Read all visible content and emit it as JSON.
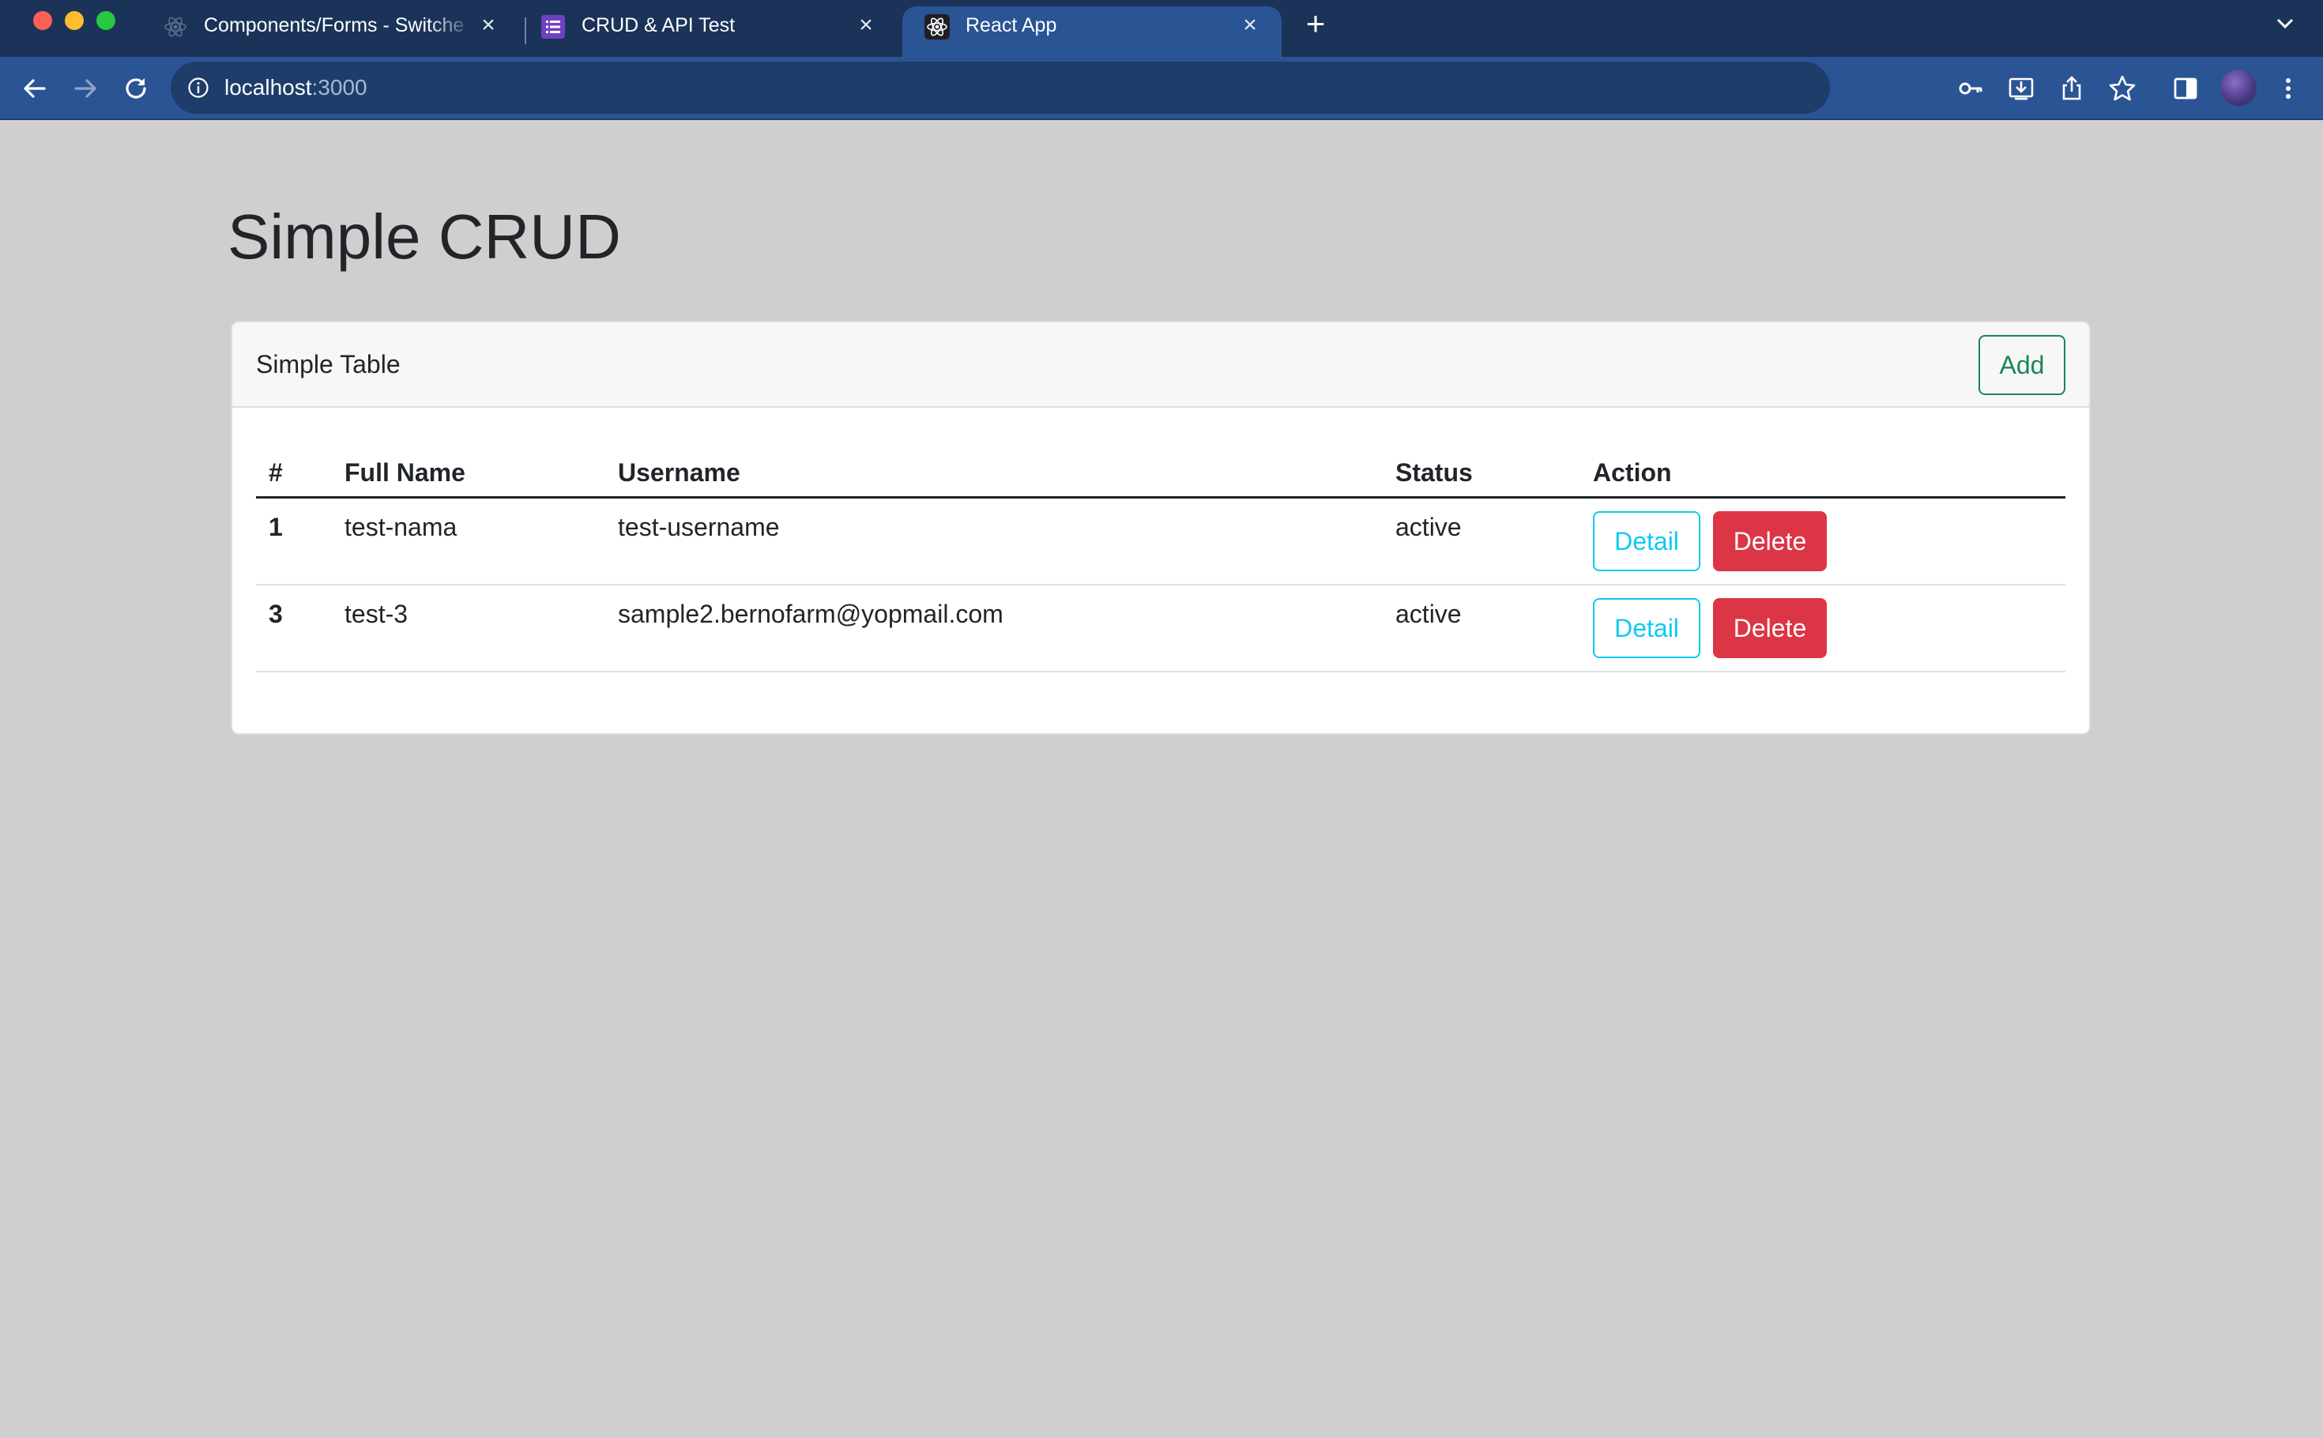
{
  "browser": {
    "tabs": [
      {
        "title": "Components/Forms - Switches",
        "active": false,
        "icon": "react-icon"
      },
      {
        "title": "CRUD & API Test",
        "active": false,
        "icon": "list-icon"
      },
      {
        "title": "React App",
        "active": true,
        "icon": "react-icon"
      }
    ],
    "url_host": "localhost",
    "url_port": ":3000",
    "colors": {
      "tabbar": "#1b3358",
      "toolbar": "#2a5494",
      "active_tab": "#2a5494"
    }
  },
  "page": {
    "title": "Simple CRUD",
    "background": "#cfcfcf"
  },
  "card": {
    "title": "Simple Table",
    "add_label": "Add"
  },
  "table": {
    "headers": [
      "#",
      "Full Name",
      "Username",
      "Status",
      "Action"
    ],
    "rows": [
      {
        "id": "1",
        "full_name": "test-nama",
        "username": "test-username",
        "status": "active",
        "detail_label": "Detail",
        "delete_label": "Delete"
      },
      {
        "id": "3",
        "full_name": "test-3",
        "username": "sample2.bernofarm@yopmail.com",
        "status": "active",
        "detail_label": "Detail",
        "delete_label": "Delete"
      }
    ]
  },
  "colors": {
    "add": "#198754",
    "detail": "#0dcaf0",
    "delete": "#dc3545"
  }
}
